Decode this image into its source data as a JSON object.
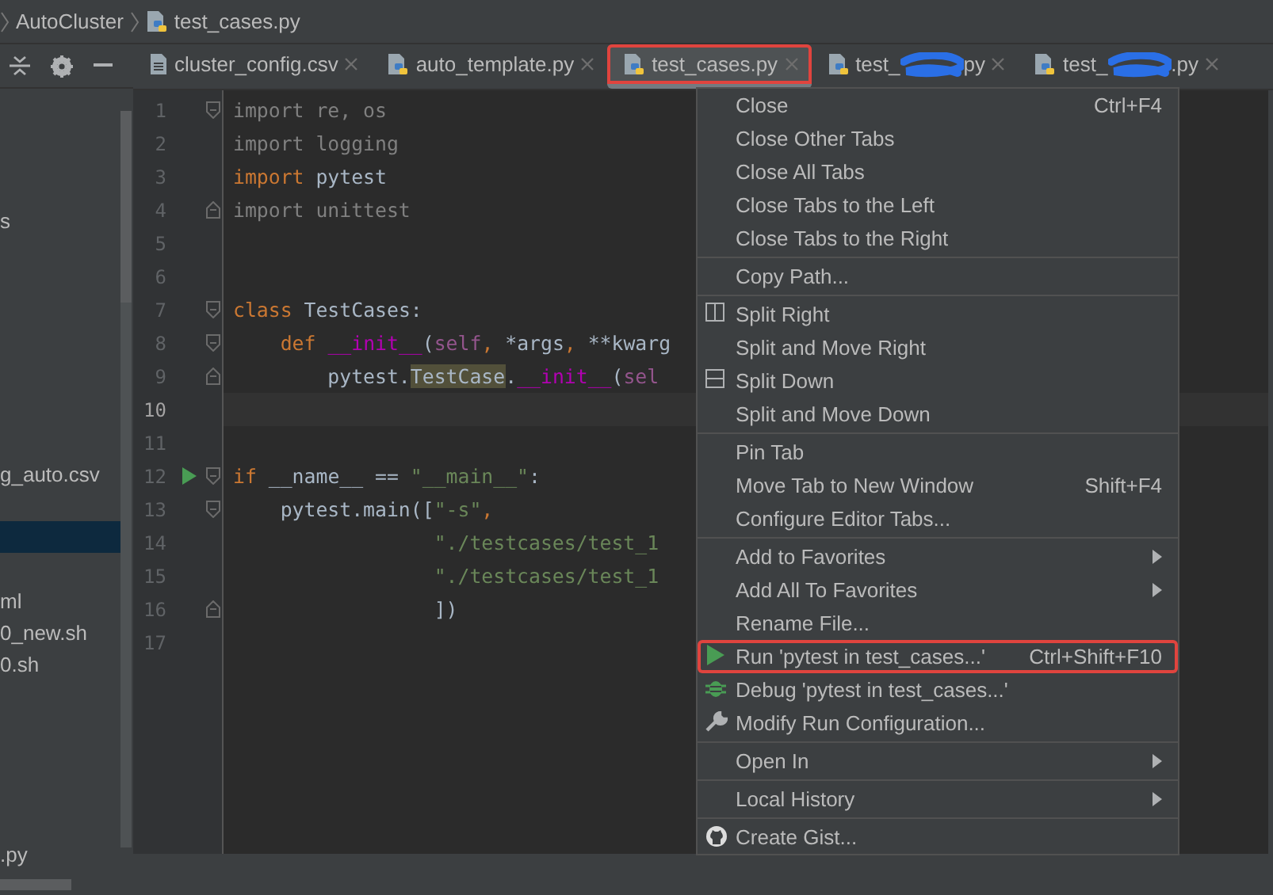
{
  "breadcrumb": [
    {
      "text": "AutoCluster",
      "kind": "folder"
    },
    {
      "text": "test_cases.py",
      "kind": "python"
    }
  ],
  "sidebar": {
    "items": [
      {
        "text": "s",
        "selected": false
      },
      {
        "text": "g_auto.csv",
        "selected": false
      },
      {
        "selected": true
      },
      {
        "text": "ml",
        "selected": false
      },
      {
        "text": "0_new.sh",
        "selected": false
      },
      {
        "text": "0.sh",
        "selected": false
      },
      {
        "text": ".py",
        "selected": false
      }
    ]
  },
  "tabs": [
    {
      "label": "cluster_config.csv",
      "kind": "text",
      "selected": false,
      "annotated": false,
      "redacted": false
    },
    {
      "label": "auto_template.py",
      "kind": "python",
      "selected": false,
      "annotated": false,
      "redacted": false
    },
    {
      "label": "test_cases.py",
      "kind": "python",
      "selected": true,
      "annotated": true,
      "redacted": false
    },
    {
      "label": "test_",
      "label_end": "py",
      "kind": "python",
      "selected": false,
      "annotated": false,
      "redacted": true
    },
    {
      "label": "test_",
      "label_end": ".py",
      "kind": "python",
      "selected": false,
      "annotated": false,
      "redacted": true
    }
  ],
  "code": [
    {
      "number": "1",
      "current": false,
      "fold_start": true,
      "tokens": [
        {
          "text": "import re, os",
          "kind": "unused"
        }
      ]
    },
    {
      "number": "2",
      "current": false,
      "tokens": [
        {
          "text": "import logging",
          "kind": "unused"
        }
      ]
    },
    {
      "number": "3",
      "current": false,
      "tokens": [
        {
          "text": "import ",
          "kind": "keyword"
        },
        {
          "text": "pytest",
          "kind": "plain"
        }
      ]
    },
    {
      "number": "4",
      "current": false,
      "fold_end": true,
      "tokens": [
        {
          "text": "import unittest",
          "kind": "unused"
        }
      ]
    },
    {
      "number": "5",
      "current": false
    },
    {
      "number": "6",
      "current": false
    },
    {
      "number": "7",
      "current": false,
      "fold_start": true,
      "tokens": [
        {
          "text": "class ",
          "kind": "keyword"
        },
        {
          "text": "TestCases:",
          "kind": "plain"
        }
      ]
    },
    {
      "number": "8",
      "current": false,
      "fold_start": true,
      "tokens": [
        {
          "text": "    def ",
          "kind": "keyword"
        },
        {
          "text": "__init__",
          "kind": "dunder"
        },
        {
          "text": "(",
          "kind": "plain"
        },
        {
          "text": "self",
          "kind": "self"
        },
        {
          "text": ", ",
          "kind": "keyword"
        },
        {
          "text": "*args",
          "kind": "plain"
        },
        {
          "text": ", ",
          "kind": "keyword"
        },
        {
          "text": "**kwarg",
          "kind": "plain"
        }
      ]
    },
    {
      "number": "9",
      "current": false,
      "fold_end": true,
      "tokens": [
        {
          "text": "        pytest.",
          "kind": "plain"
        },
        {
          "text": "TestCase",
          "kind": "match"
        },
        {
          "text": ".",
          "kind": "plain"
        },
        {
          "text": "__init__",
          "kind": "dunder"
        },
        {
          "text": "(",
          "kind": "plain"
        },
        {
          "text": "sel",
          "kind": "self"
        }
      ]
    },
    {
      "number": "10",
      "current": true
    },
    {
      "number": "11",
      "current": false
    },
    {
      "number": "12",
      "current": false,
      "fold_start": true,
      "run_marker": true,
      "tokens": [
        {
          "text": "if ",
          "kind": "keyword"
        },
        {
          "text": "__name__ == ",
          "kind": "plain"
        },
        {
          "text": "\"__main__\"",
          "kind": "string"
        },
        {
          "text": ":",
          "kind": "plain"
        }
      ]
    },
    {
      "number": "13",
      "current": false,
      "fold_start": true,
      "tokens": [
        {
          "text": "    pytest.main([",
          "kind": "plain"
        },
        {
          "text": "\"-s\"",
          "kind": "string"
        },
        {
          "text": ",",
          "kind": "keyword"
        }
      ]
    },
    {
      "number": "14",
      "current": false,
      "tokens": [
        {
          "text": "                 \"./testcases/test_1",
          "kind": "string"
        }
      ]
    },
    {
      "number": "15",
      "current": false,
      "tokens": [
        {
          "text": "                 \"./testcases/test_1",
          "kind": "string"
        }
      ]
    },
    {
      "number": "16",
      "current": false,
      "fold_end": true,
      "tokens": [
        {
          "text": "                 ])",
          "kind": "plain"
        }
      ]
    },
    {
      "number": "17",
      "current": false
    }
  ],
  "context_menu": {
    "groups": [
      [
        {
          "label": "Close",
          "shortcut": "Ctrl+F4",
          "kind": "plain",
          "submenu": false,
          "annotated": false
        },
        {
          "label": "Close Other Tabs",
          "kind": "plain",
          "submenu": false,
          "annotated": false
        },
        {
          "label": "Close All Tabs",
          "kind": "plain",
          "submenu": false,
          "annotated": false
        },
        {
          "label": "Close Tabs to the Left",
          "kind": "plain",
          "submenu": false,
          "annotated": false
        },
        {
          "label": "Close Tabs to the Right",
          "kind": "plain",
          "submenu": false,
          "annotated": false
        }
      ],
      [
        {
          "label": "Copy Path...",
          "kind": "plain",
          "submenu": false,
          "annotated": false
        }
      ],
      [
        {
          "label": "Split Right",
          "kind": "split-right",
          "submenu": false,
          "annotated": false
        },
        {
          "label": "Split and Move Right",
          "kind": "plain",
          "submenu": false,
          "annotated": false
        },
        {
          "label": "Split Down",
          "kind": "split-down",
          "submenu": false,
          "annotated": false
        },
        {
          "label": "Split and Move Down",
          "kind": "plain",
          "submenu": false,
          "annotated": false
        }
      ],
      [
        {
          "label": "Pin Tab",
          "kind": "plain",
          "submenu": false,
          "annotated": false
        },
        {
          "label": "Move Tab to New Window",
          "shortcut": "Shift+F4",
          "kind": "plain",
          "submenu": false,
          "annotated": false
        },
        {
          "label": "Configure Editor Tabs...",
          "kind": "plain",
          "submenu": false,
          "annotated": false
        }
      ],
      [
        {
          "label": "Add to Favorites",
          "kind": "plain",
          "submenu": true,
          "annotated": false
        },
        {
          "label": "Add All To Favorites",
          "kind": "plain",
          "submenu": true,
          "annotated": false
        },
        {
          "label": "Rename File...",
          "kind": "plain",
          "submenu": false,
          "annotated": false
        },
        {
          "label": "Run 'pytest in test_cases...'",
          "shortcut": "Ctrl+Shift+F10",
          "kind": "run",
          "submenu": false,
          "annotated": true
        },
        {
          "label": "Debug 'pytest in test_cases...'",
          "kind": "debug",
          "submenu": false,
          "annotated": false
        },
        {
          "label": "Modify Run Configuration...",
          "kind": "wrench",
          "submenu": false,
          "annotated": false
        }
      ],
      [
        {
          "label": "Open In",
          "kind": "plain",
          "submenu": true,
          "annotated": false
        }
      ],
      [
        {
          "label": "Local History",
          "kind": "plain",
          "submenu": true,
          "annotated": false
        }
      ],
      [
        {
          "label": "Create Gist...",
          "kind": "github",
          "submenu": false,
          "annotated": false
        }
      ]
    ]
  }
}
